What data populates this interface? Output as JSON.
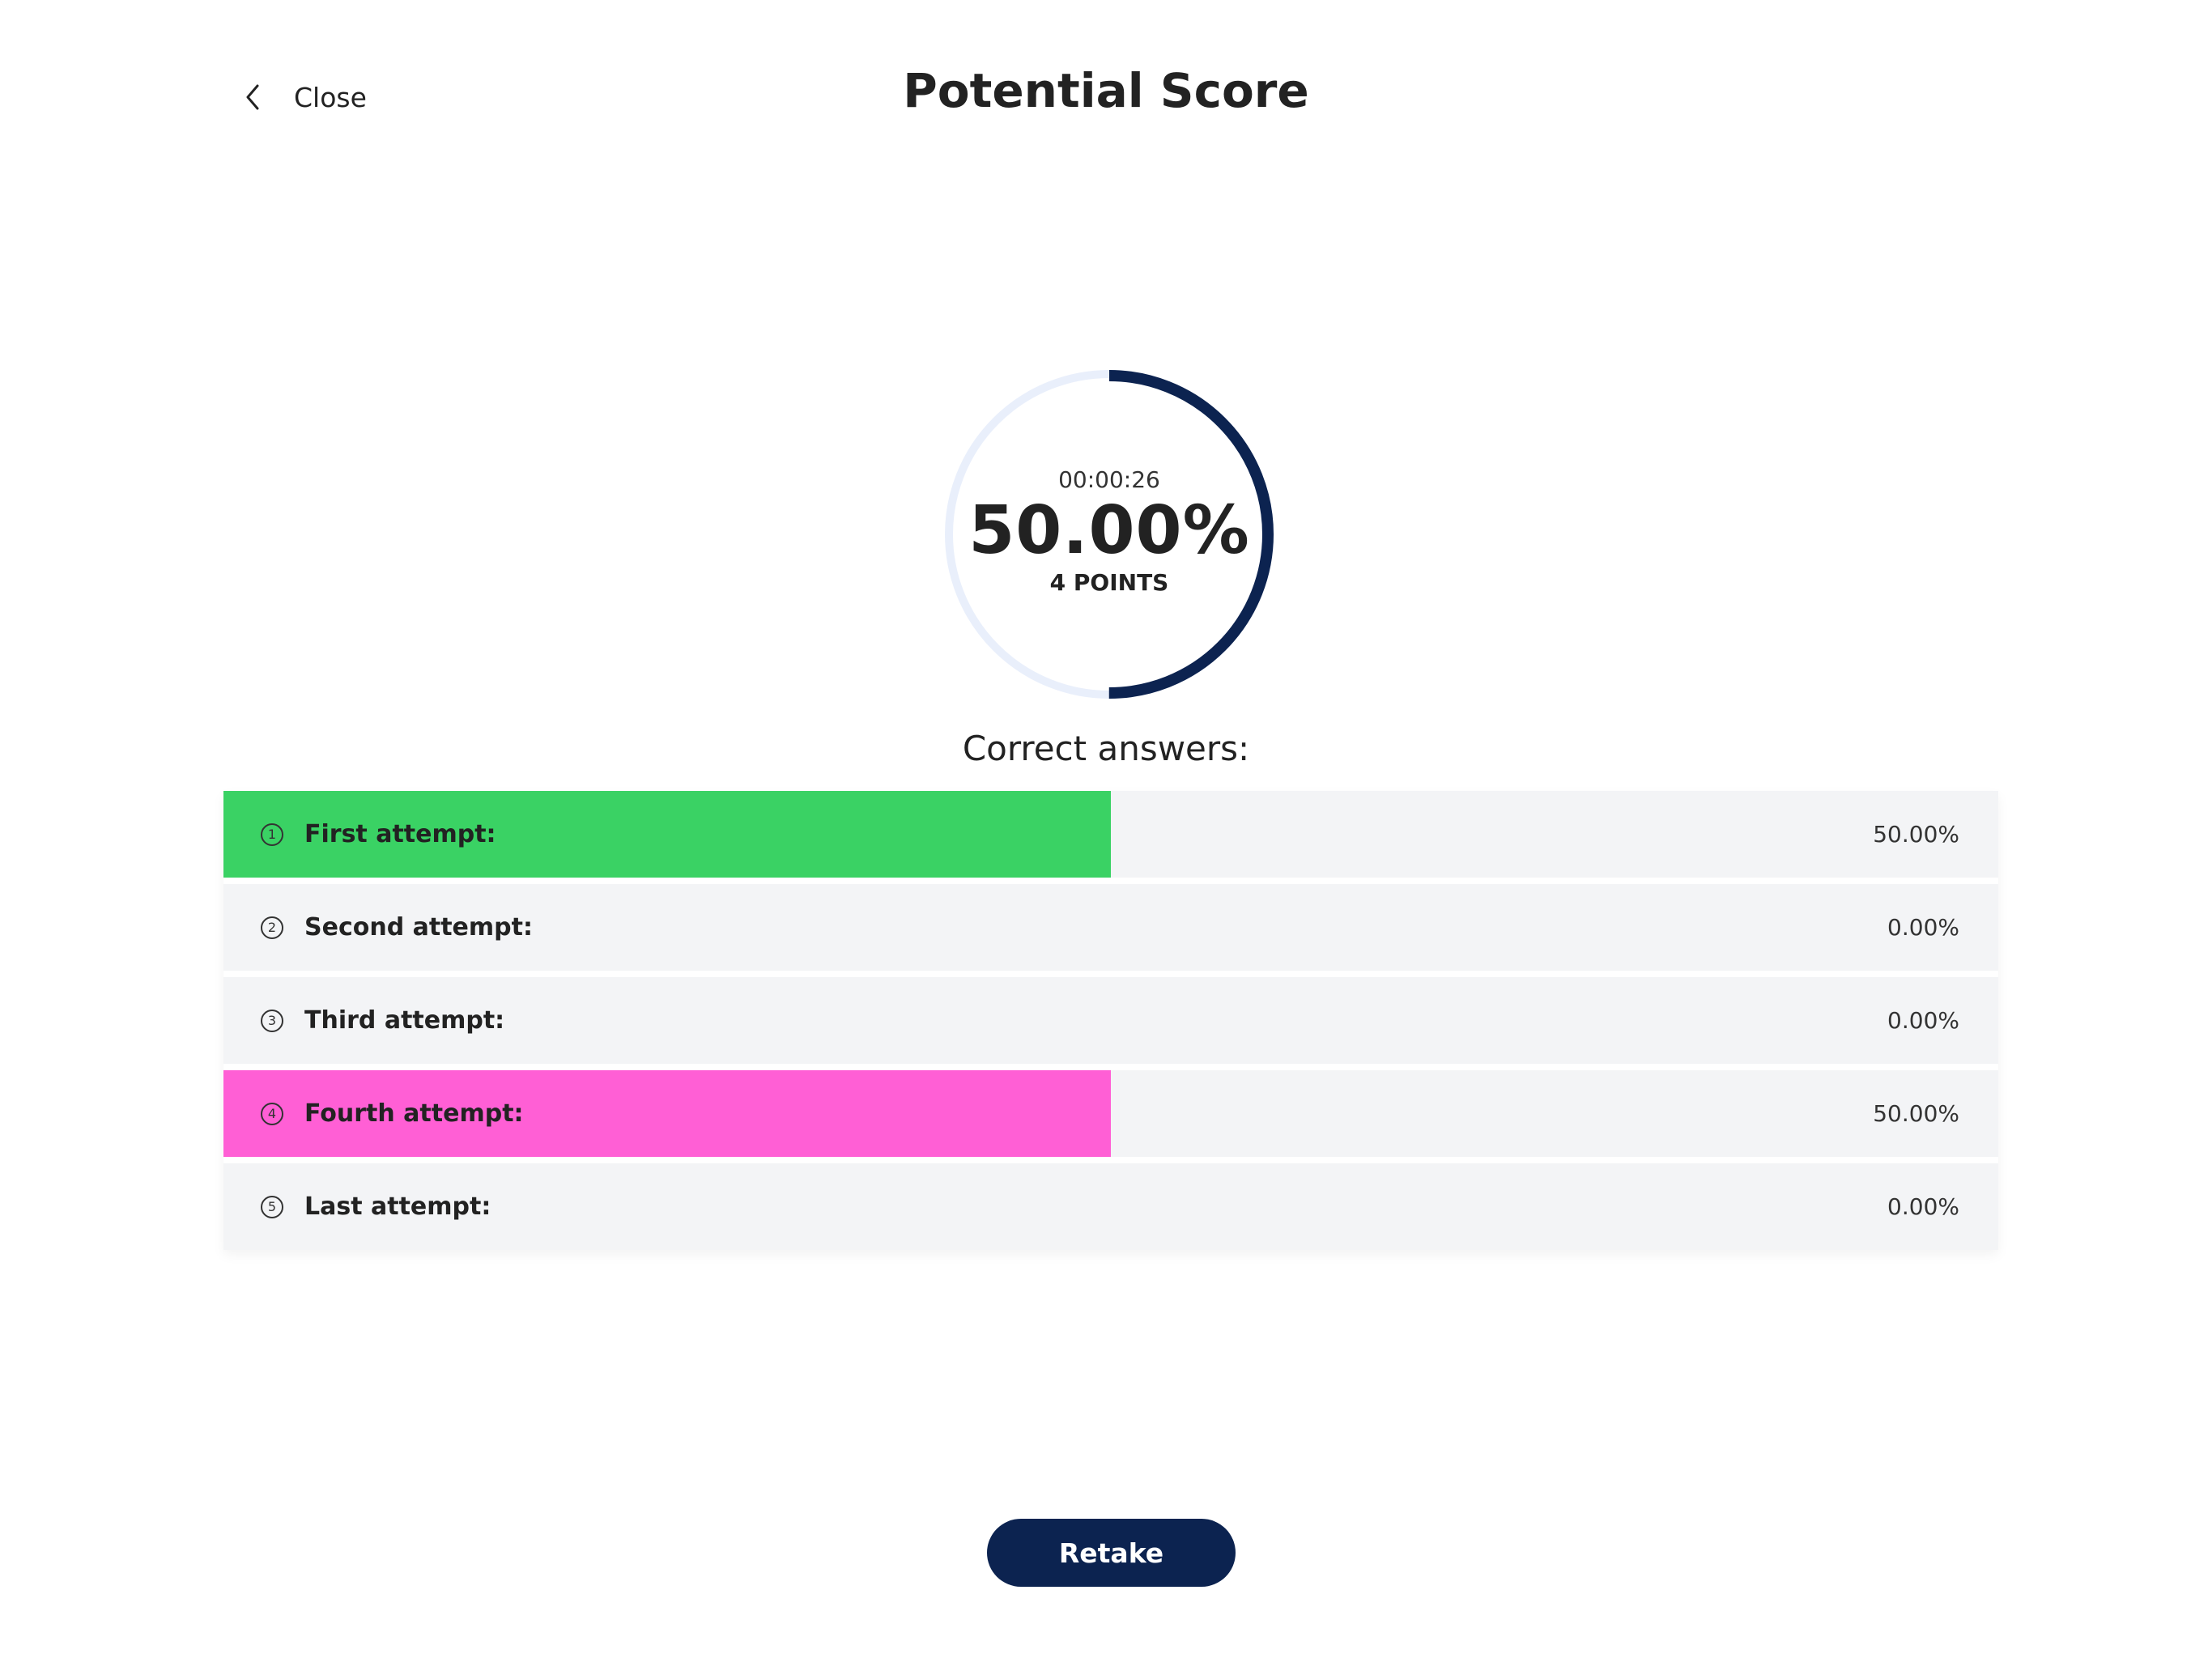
{
  "header": {
    "close_label": "Close",
    "title": "Potential Score",
    "close_icon": "chevron-left-icon"
  },
  "score": {
    "timer": "00:00:26",
    "percent_label": "50.00%",
    "points_label": "4 POINTS",
    "progress_fraction": 0.5,
    "ring_color": "#0c2350",
    "ring_track_color": "#e9effb"
  },
  "results": {
    "title": "Correct answers:",
    "attempts": [
      {
        "num": "1",
        "label": "First attempt:",
        "value": "50.00%",
        "fraction": 0.5,
        "color": "#3ad264"
      },
      {
        "num": "2",
        "label": "Second attempt:",
        "value": "0.00%",
        "fraction": 0,
        "color": "#3ad264"
      },
      {
        "num": "3",
        "label": "Third attempt:",
        "value": "0.00%",
        "fraction": 0,
        "color": "#3ad264"
      },
      {
        "num": "4",
        "label": "Fourth attempt:",
        "value": "50.00%",
        "fraction": 0.5,
        "color": "#ff5fd5"
      },
      {
        "num": "5",
        "label": "Last attempt:",
        "value": "0.00%",
        "fraction": 0,
        "color": "#3ad264"
      }
    ]
  },
  "actions": {
    "retake_label": "Retake",
    "button_color": "#0c2350"
  }
}
